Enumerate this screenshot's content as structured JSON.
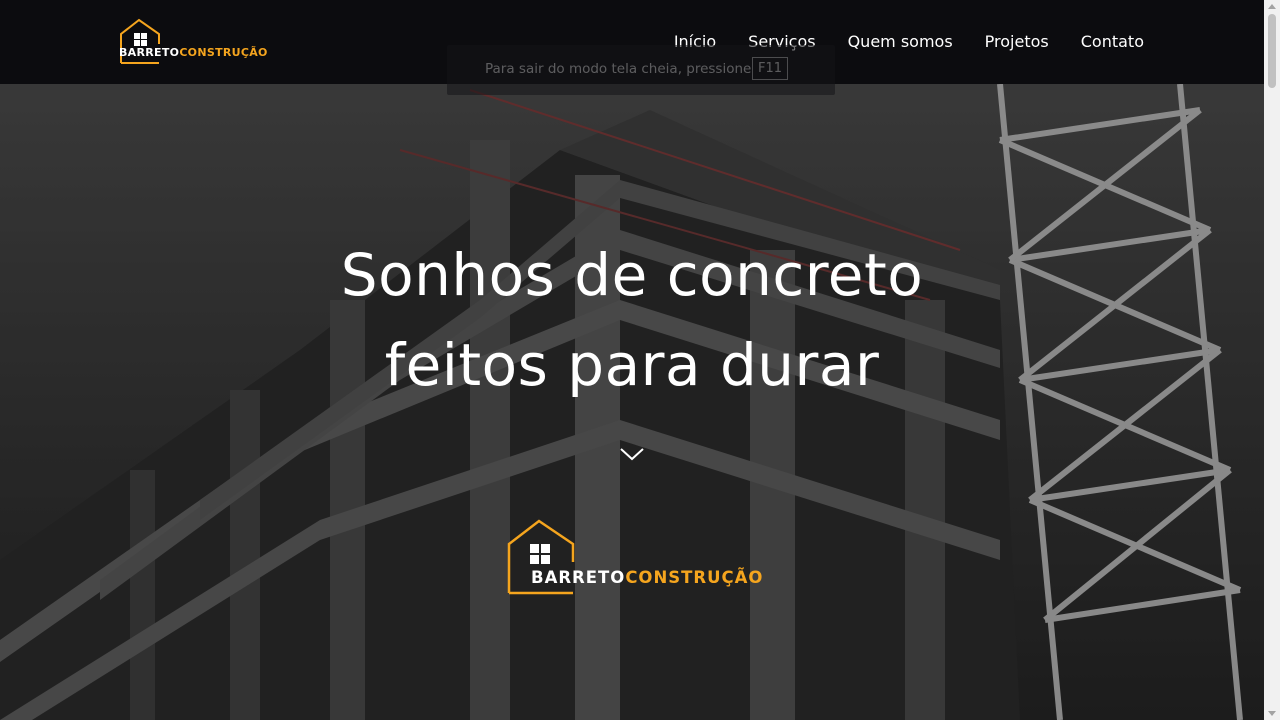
{
  "brand": {
    "name_part1": "BARRETO",
    "name_part2": "CONSTRUÇÃO",
    "accent_color": "#f5a51e",
    "icon": "house-window-icon"
  },
  "nav": {
    "items": [
      {
        "label": "Início"
      },
      {
        "label": "Serviços"
      },
      {
        "label": "Quem somos"
      },
      {
        "label": "Projetos"
      },
      {
        "label": "Contato"
      }
    ]
  },
  "fullscreen_notice": {
    "text": "Para sair do modo tela cheia, pressione",
    "key": "F11"
  },
  "hero": {
    "headline_line1": "Sonhos de concreto",
    "headline_line2": "feitos para durar",
    "scroll_icon": "chevron-down-icon",
    "background": "concrete-building-under-construction-with-crane"
  }
}
